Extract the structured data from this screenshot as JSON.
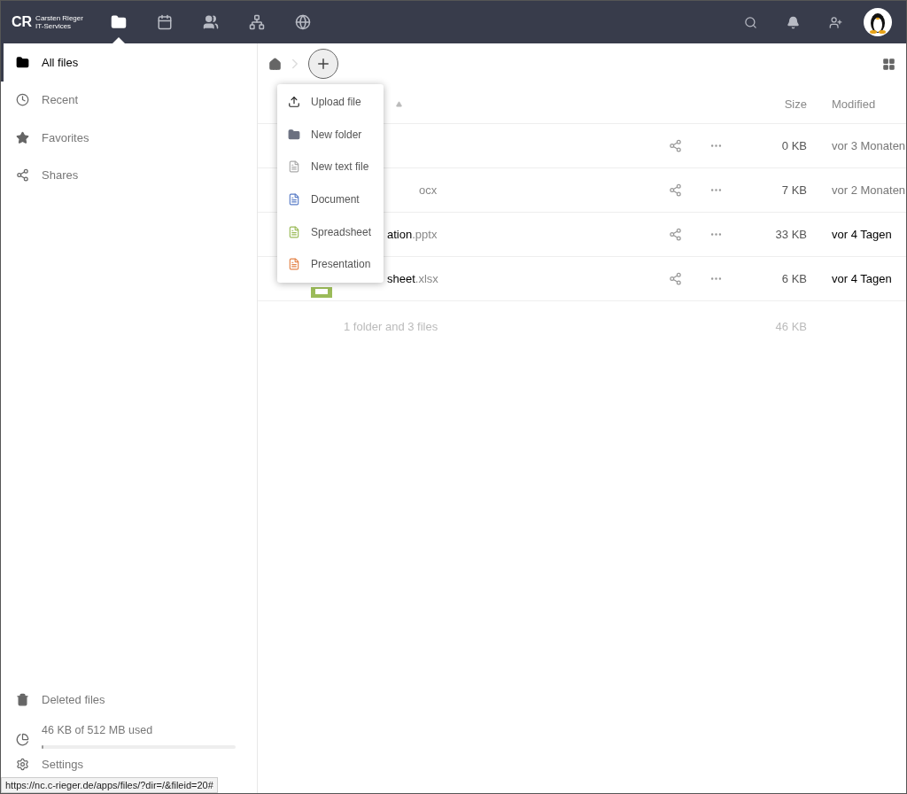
{
  "header": {
    "logo": {
      "initials": "CR",
      "line_1": "Carsten Rieger",
      "line_2": "IT-Services"
    },
    "apps": [
      {
        "kind": "files",
        "selected": true
      },
      {
        "kind": "calendar",
        "selected": false
      },
      {
        "kind": "contacts",
        "selected": false
      },
      {
        "kind": "network",
        "selected": false
      },
      {
        "kind": "globe",
        "selected": false
      }
    ]
  },
  "sidebar": {
    "items": [
      {
        "label": "All files",
        "kind": "files",
        "selected": true
      },
      {
        "label": "Recent",
        "kind": "recent",
        "selected": false
      },
      {
        "label": "Favorites",
        "kind": "favorites",
        "selected": false
      },
      {
        "label": "Shares",
        "kind": "shares",
        "selected": false
      }
    ],
    "deleted": "Deleted files",
    "quota": {
      "text": "46 KB of 512 MB used",
      "level": 0.01
    },
    "settings": "Settings"
  },
  "new_menu": [
    {
      "label": "Upload file",
      "kind": "upload"
    },
    {
      "label": "New folder",
      "kind": "folder"
    },
    {
      "label": "New text file",
      "kind": "text"
    },
    {
      "label": "Document",
      "kind": "document"
    },
    {
      "label": "Spreadsheet",
      "kind": "spreadsheet"
    },
    {
      "label": "Presentation",
      "kind": "presentation"
    }
  ],
  "table": {
    "columns": [
      "Size",
      "Modified"
    ],
    "rows": [
      {
        "name": "",
        "ext": "",
        "kind": "folder",
        "size": "0 KB",
        "modified": "vor 3 Monaten",
        "recent": false
      },
      {
        "name": "",
        "ext": "ocx",
        "kind": "document",
        "size": "7 KB",
        "modified": "vor 2 Monaten",
        "recent": false
      },
      {
        "name": "ation",
        "ext": ".pptx",
        "kind": "presentation",
        "size": "33 KB",
        "modified": "vor 4 Tagen",
        "recent": true
      },
      {
        "name": "sheet",
        "ext": ".xlsx",
        "kind": "spreadsheet",
        "size": "6 KB",
        "modified": "vor 4 Tagen",
        "recent": true
      }
    ],
    "summary": {
      "text": "1 folder and 3 files",
      "size": "46 KB"
    }
  },
  "status_url": "https://nc.c-rieger.de/apps/files/?dir=/&fileid=20#"
}
